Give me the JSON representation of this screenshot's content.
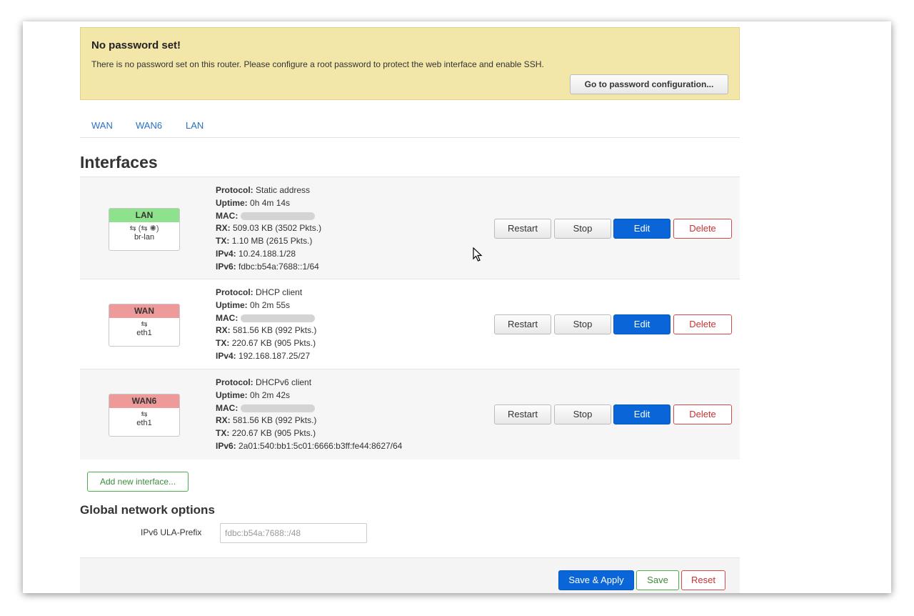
{
  "alert": {
    "title": "No password set!",
    "text": "There is no password set on this router. Please configure a root password to protect the web interface and enable SSH.",
    "button": "Go to password configuration..."
  },
  "tabs": [
    "WAN",
    "WAN6",
    "LAN"
  ],
  "interfaces_heading": "Interfaces",
  "labels": {
    "protocol": "Protocol:",
    "uptime": "Uptime:",
    "mac": "MAC:",
    "rx": "RX:",
    "tx": "TX:",
    "ipv4": "IPv4:",
    "ipv6": "IPv6:"
  },
  "interfaces": [
    {
      "name": "LAN",
      "device": "br-lan",
      "color": "#8ee28e",
      "icons": "⇆ (⇆ ✺)",
      "protocol": "Static address",
      "uptime": "0h 4m 14s",
      "rx": "509.03 KB (3502 Pkts.)",
      "tx": "1.10 MB (2615 Pkts.)",
      "ipv4": "10.24.188.1/28",
      "ipv6": "fdbc:b54a:7688::1/64"
    },
    {
      "name": "WAN",
      "device": "eth1",
      "color": "#ef9a9a",
      "icons": "⇆",
      "protocol": "DHCP client",
      "uptime": "0h 2m 55s",
      "rx": "581.56 KB (992 Pkts.)",
      "tx": "220.67 KB (905 Pkts.)",
      "ipv4": "192.168.187.25/27"
    },
    {
      "name": "WAN6",
      "device": "eth1",
      "color": "#ef9a9a",
      "icons": "⇆",
      "protocol": "DHCPv6 client",
      "uptime": "0h 2m 42s",
      "rx": "581.56 KB (992 Pkts.)",
      "tx": "220.67 KB (905 Pkts.)",
      "ipv6": "2a01:540:bb1:5c01:6666:b3ff:fe44:8627/64"
    }
  ],
  "row_buttons": {
    "restart": "Restart",
    "stop": "Stop",
    "edit": "Edit",
    "delete": "Delete"
  },
  "add_interface": "Add new interface...",
  "global": {
    "heading": "Global network options",
    "ula_label": "IPv6 ULA-Prefix",
    "ula_value": "fdbc:b54a:7688::/48"
  },
  "footer": {
    "save_apply": "Save & Apply",
    "save": "Save",
    "reset": "Reset"
  },
  "colors": {
    "primary": "#0a66d8",
    "danger": "#c83232",
    "success": "#3d8b3d",
    "alert_bg": "#f2e6a9"
  }
}
